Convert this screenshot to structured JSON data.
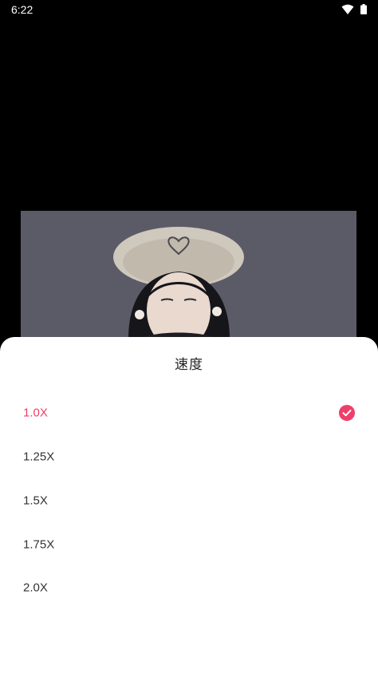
{
  "status_bar": {
    "time": "6:22",
    "wifi_icon": "wifi-icon",
    "battery_icon": "battery-icon"
  },
  "sheet": {
    "title": "速度",
    "options": [
      {
        "label": "1.0X",
        "selected": true
      },
      {
        "label": "1.25X",
        "selected": false
      },
      {
        "label": "1.5X",
        "selected": false
      },
      {
        "label": "1.75X",
        "selected": false
      },
      {
        "label": "2.0X",
        "selected": false
      }
    ],
    "selected_icon": "check-circle-icon"
  },
  "colors": {
    "accent": "#ee3f6a",
    "status_background": "#000000",
    "sheet_background": "#ffffff",
    "text": "#333333"
  }
}
